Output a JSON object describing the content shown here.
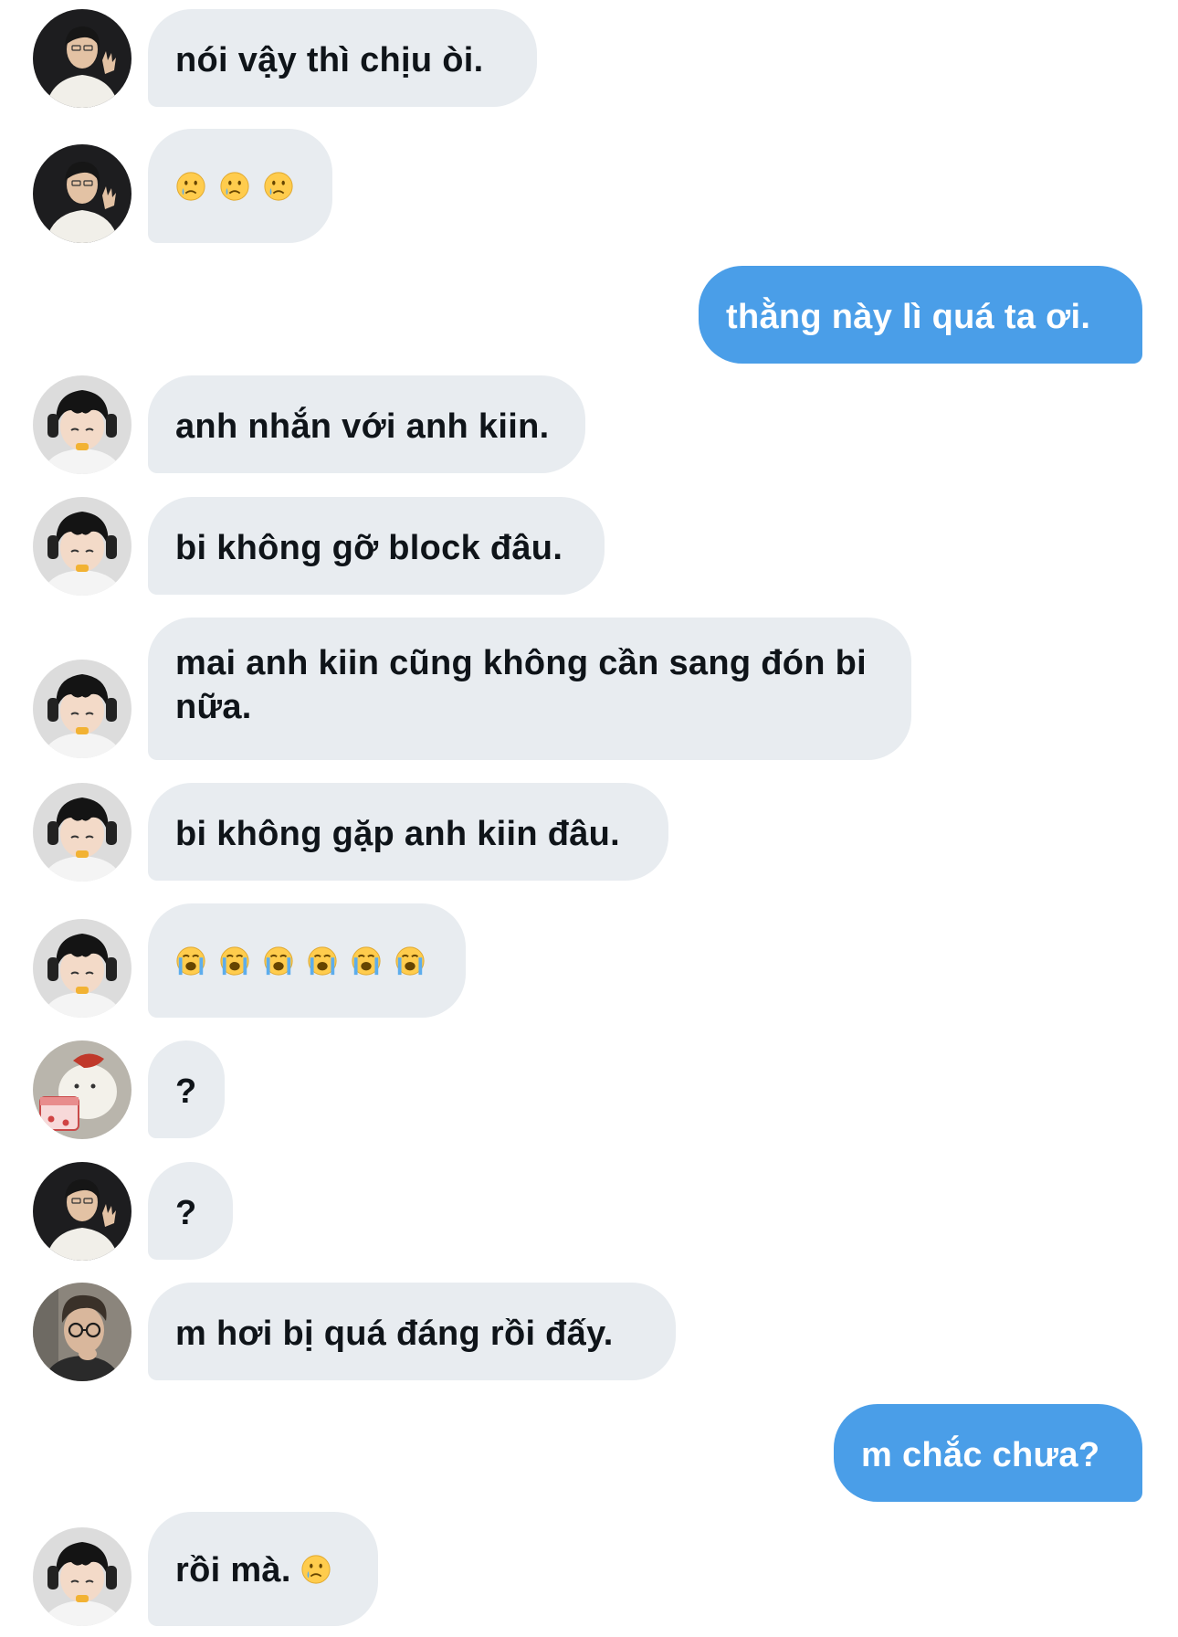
{
  "colors": {
    "incoming_bubble": "#e8ecf0",
    "outgoing_bubble": "#4a9ee8",
    "incoming_text": "#0f1419",
    "outgoing_text": "#ffffff"
  },
  "messages": [
    {
      "direction": "in",
      "avatar": "avatar-man-white-shirt",
      "text": "nói vậy thì chịu òi."
    },
    {
      "direction": "in",
      "avatar": "avatar-man-white-shirt",
      "emojis": [
        "crying-face-emoji",
        "crying-face-emoji",
        "crying-face-emoji"
      ]
    },
    {
      "direction": "out",
      "text": "thằng này lì quá ta ơi."
    },
    {
      "direction": "in",
      "avatar": "avatar-boy-headphones",
      "text": "anh nhắn với anh kiin."
    },
    {
      "direction": "in",
      "avatar": "avatar-boy-headphones",
      "text": "bi không gỡ block đâu."
    },
    {
      "direction": "in",
      "avatar": "avatar-boy-headphones",
      "text": "mai anh kiin cũng không cần sang đón bi nữa."
    },
    {
      "direction": "in",
      "avatar": "avatar-boy-headphones",
      "text": "bi không gặp anh kiin đâu."
    },
    {
      "direction": "in",
      "avatar": "avatar-boy-headphones",
      "emojis": [
        "loudly-crying-face-emoji",
        "loudly-crying-face-emoji",
        "loudly-crying-face-emoji",
        "loudly-crying-face-emoji",
        "loudly-crying-face-emoji",
        "loudly-crying-face-emoji"
      ]
    },
    {
      "direction": "in",
      "avatar": "avatar-cartoon-bear",
      "text": "?"
    },
    {
      "direction": "in",
      "avatar": "avatar-man-white-shirt",
      "text": "?"
    },
    {
      "direction": "in",
      "avatar": "avatar-man-glasses",
      "text": "m hơi bị quá đáng rồi đấy."
    },
    {
      "direction": "out",
      "text": "m chắc chưa?"
    },
    {
      "direction": "in",
      "avatar": "avatar-boy-headphones",
      "text": "rồi mà.",
      "trailing_emoji": "crying-face-emoji"
    }
  ]
}
